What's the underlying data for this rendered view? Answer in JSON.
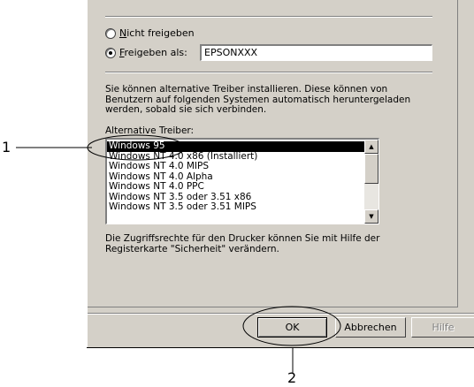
{
  "sharing": {
    "not_shared_label": "Nicht freigeben",
    "not_shared_accesskey": "N",
    "not_shared_rest": "icht freigeben",
    "shared_as_accesskey": "F",
    "shared_as_rest": "reigeben als:",
    "share_name_value": "EPSONXXX"
  },
  "drivers": {
    "info_text": "Sie können alternative Treiber installieren. Diese können von Benutzern auf folgenden Systemen automatisch heruntergeladen werden, sobald sie sich verbinden.",
    "list_label": "Alternative Treiber:",
    "items": [
      "Windows 95",
      "Windows NT 4.0 x86 (Installiert)",
      "Windows NT 4.0 MIPS",
      "Windows NT 4.0 Alpha",
      "Windows NT 4.0 PPC",
      "Windows NT 3.5 oder 3.51 x86",
      "Windows NT 3.5 oder 3.51 MIPS"
    ],
    "selected_index": 0
  },
  "security_text": "Die Zugriffsrechte für den Drucker können Sie mit Hilfe der Registerkarte \"Sicherheit\" verändern.",
  "buttons": {
    "ok": "OK",
    "cancel": "Abbrechen",
    "help": "Hilfe"
  },
  "callouts": {
    "one": "1",
    "two": "2"
  },
  "icons": {
    "scroll_up": "scroll-up-arrow-icon",
    "scroll_down": "scroll-down-arrow-icon"
  }
}
